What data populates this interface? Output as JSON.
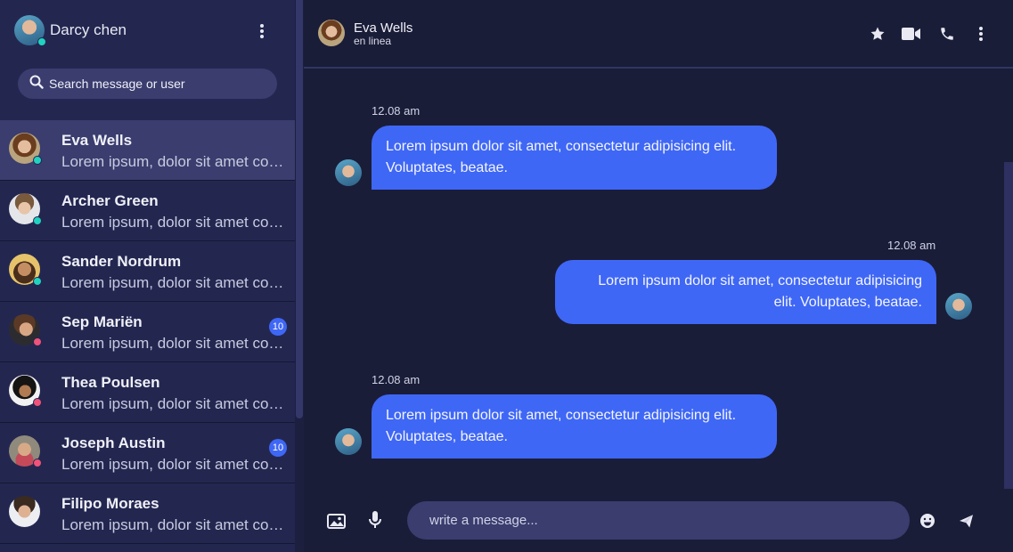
{
  "me": {
    "name": "Darcy chen",
    "status": "online"
  },
  "search": {
    "placeholder": "Search message or user"
  },
  "contacts": [
    {
      "name": "Eva Wells",
      "preview": "Lorem ipsum, dolor sit amet consectetur adipisicing elit.",
      "status": "online",
      "badge": "",
      "active": true
    },
    {
      "name": "Archer Green",
      "preview": "Lorem ipsum, dolor sit amet consectetur adipisicing elit.",
      "status": "online",
      "badge": ""
    },
    {
      "name": "Sander Nordrum",
      "preview": "Lorem ipsum, dolor sit amet consectetur adipisicing elit.",
      "status": "online",
      "badge": ""
    },
    {
      "name": "Sep Mariën",
      "preview": "Lorem ipsum, dolor sit amet consectetur adipisicing elit.",
      "status": "offline",
      "badge": "10"
    },
    {
      "name": "Thea Poulsen",
      "preview": "Lorem ipsum, dolor sit amet consectetur adipisicing elit.",
      "status": "offline",
      "badge": ""
    },
    {
      "name": "Joseph Austin",
      "preview": "Lorem ipsum, dolor sit amet consectetur adipisicing elit.",
      "status": "offline",
      "badge": "10"
    },
    {
      "name": "Filipo Moraes",
      "preview": "Lorem ipsum, dolor sit amet consectetur adipisicing elit.",
      "status": "",
      "badge": ""
    }
  ],
  "header": {
    "name": "Eva Wells",
    "status": "en linea",
    "icons": [
      "star-icon",
      "video-camera-icon",
      "phone-icon",
      "more-vertical-icon"
    ]
  },
  "messages": [
    {
      "time": "12.08 am",
      "direction": "in",
      "text": "Lorem ipsum dolor sit amet, consectetur adipisicing elit. Voluptates, beatae."
    },
    {
      "time": "12.08 am",
      "direction": "out",
      "text": "Lorem ipsum dolor sit amet, consectetur adipisicing elit. Voluptates, beatae."
    },
    {
      "time": "12.08 am",
      "direction": "in",
      "text": "Lorem ipsum dolor sit amet, consectetur adipisicing elit. Voluptates, beatae."
    }
  ],
  "composer": {
    "placeholder": "write a message...",
    "icons": [
      "image-icon",
      "microphone-icon",
      "emoji-icon",
      "send-icon"
    ]
  },
  "colors": {
    "accent": "#3f67f6",
    "sidebar": "#232750",
    "background": "#1a1d38",
    "online": "#20d3c0",
    "offline": "#f0527a"
  }
}
